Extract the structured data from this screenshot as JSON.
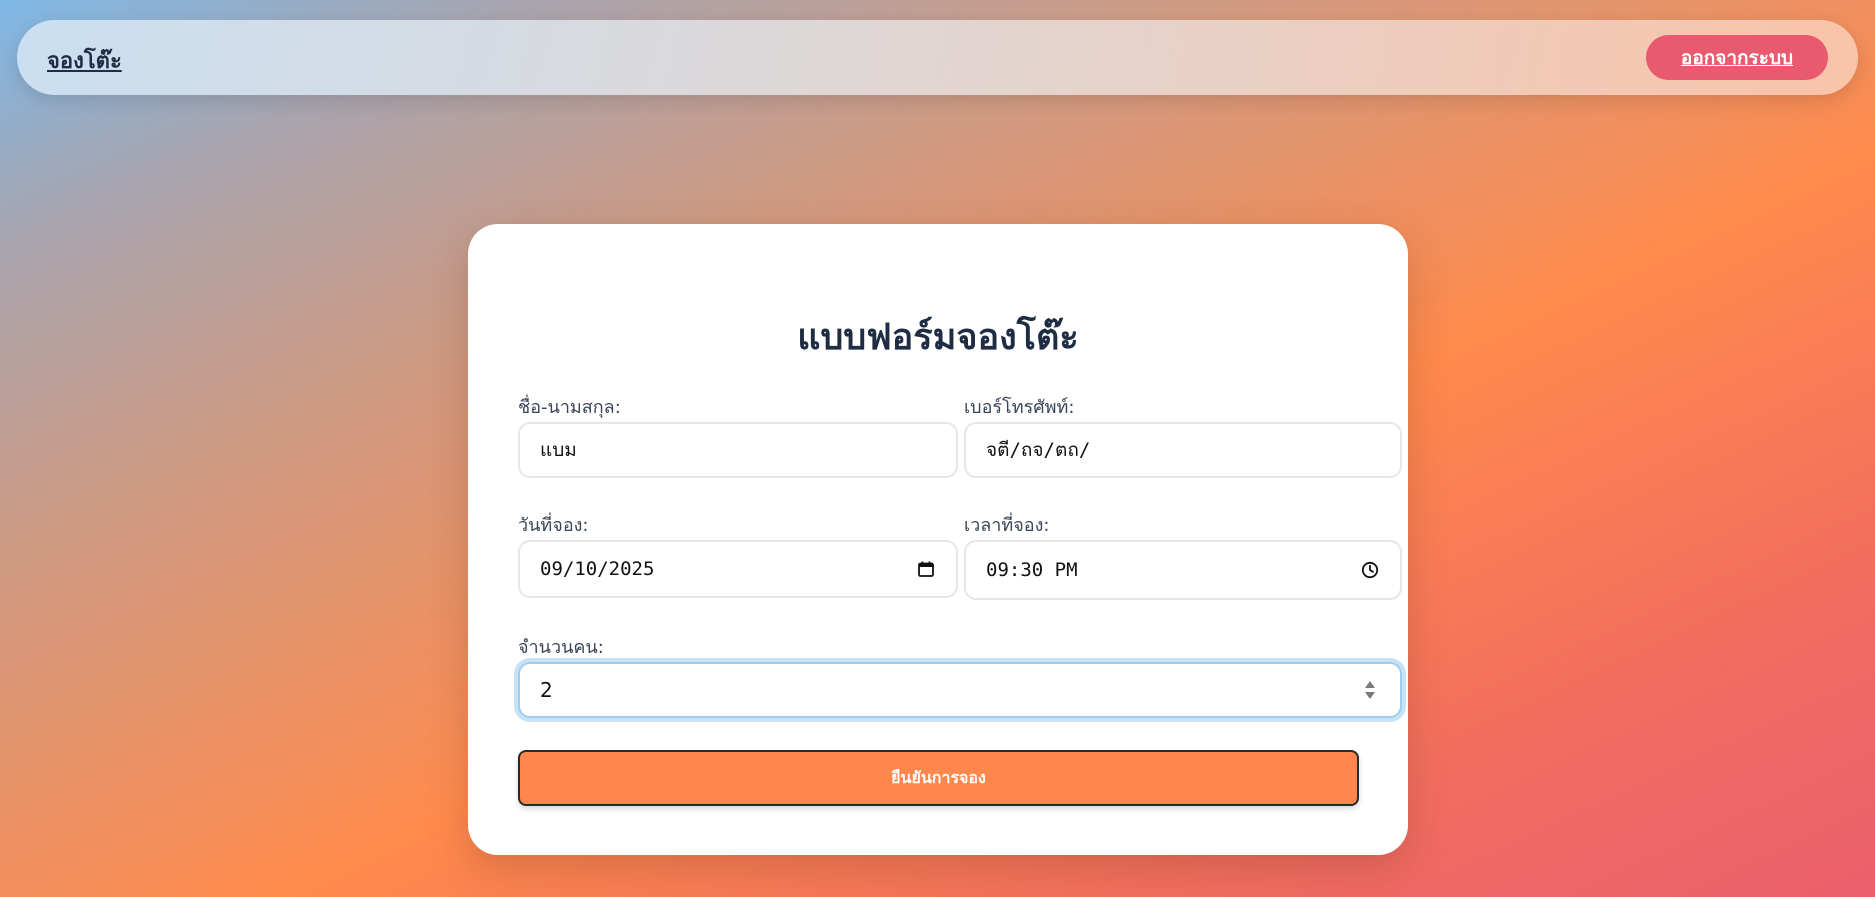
{
  "nav": {
    "brand": "จองโต๊ะ",
    "logout_label": "ออกจากระบบ"
  },
  "form": {
    "title": "แบบฟอร์มจองโต๊ะ",
    "name_label": "ชื่อ-นามสกุล:",
    "name_value": "แบม",
    "phone_label": "เบอร์โทรศัพท์:",
    "phone_value": "จตี/ถจ/ตถ/",
    "date_label": "วันที่จอง:",
    "date_value": "09/10/2025",
    "time_label": "เวลาที่จอง:",
    "time_value": "09:30 PM",
    "guests_label": "จำนวนคน:",
    "guests_value": "2",
    "submit_label": "ยืนยันการจอง"
  },
  "icons": {
    "date": "calendar-icon",
    "time": "clock-icon",
    "stepper": "stepper-arrows-icon"
  },
  "colors": {
    "logout_button": "#ea5a6f",
    "submit_button": "#ff874d",
    "focus_ring": "#c8e2f6",
    "title_text": "#1f2d44"
  }
}
